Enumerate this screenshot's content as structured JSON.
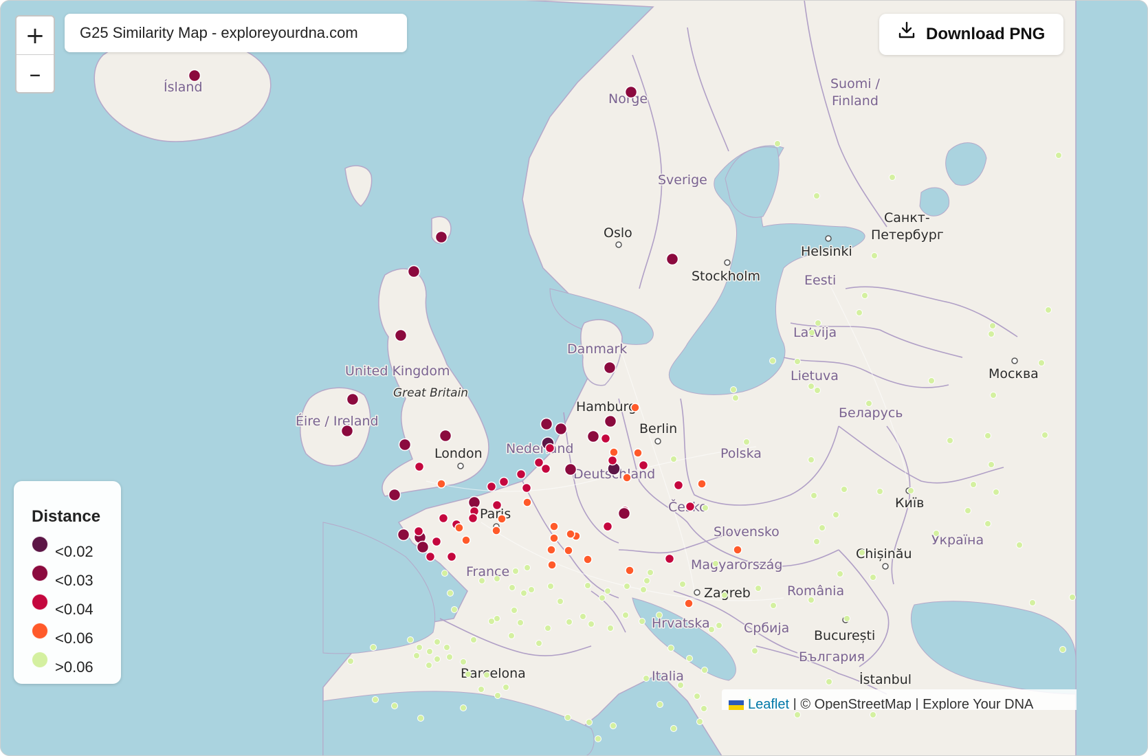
{
  "map_title": "G25 Similarity Map - exploreyourdna.com",
  "zoom": {
    "in_label": "+",
    "out_label": "–"
  },
  "download_label": "Download PNG",
  "legend": {
    "title": "Distance",
    "items": [
      {
        "label": "<0.02",
        "color": "#5c1646"
      },
      {
        "label": "<0.03",
        "color": "#8b0a3e"
      },
      {
        "label": "<0.04",
        "color": "#c4073e"
      },
      {
        "label": "<0.06",
        "color": "#ff5a2a"
      },
      {
        "label": ">0.06",
        "color": "#d4f0a0"
      }
    ]
  },
  "attribution": {
    "leaflet": "Leaflet",
    "rest": " | © OpenStreetMap | Explore Your DNA"
  },
  "place_labels": {
    "island": "Ísland",
    "norge": "Norge",
    "suomi1": "Suomi /",
    "suomi2": "Finland",
    "sverige": "Sverige",
    "oslo": "Oslo",
    "stockholm": "Stockholm",
    "helsinki": "Helsinki",
    "spb1": "Санкт-",
    "spb2": "Петербург",
    "eesti": "Eesti",
    "latvija": "Latvija",
    "danmark": "Danmark",
    "uk": "United Kingdom",
    "gb": "Great Britain",
    "ireland": "Éire / Ireland",
    "lietuva": "Lietuva",
    "moskva": "Москва",
    "hamburg": "Hamburg",
    "berlin": "Berlin",
    "belarus": "Беларусь",
    "nederland": "Nederland",
    "london": "London",
    "polska": "Polska",
    "deutschland": "Deutschland",
    "paris": "Paris",
    "cesko": "Česko",
    "kyiv": "Київ",
    "ukraina": "Україна",
    "slovensko": "Slovensko",
    "chisinau": "Chișinău",
    "france": "France",
    "magyar": "Magyarország",
    "zagreb": "Zagreb",
    "romania": "România",
    "hrvatska": "Hrvatska",
    "srbija": "Србија",
    "bucuresti": "București",
    "bulgaria": "България",
    "barcelona": "Barcelona",
    "italia": "Italia",
    "istanbul": "İstanbul"
  }
}
